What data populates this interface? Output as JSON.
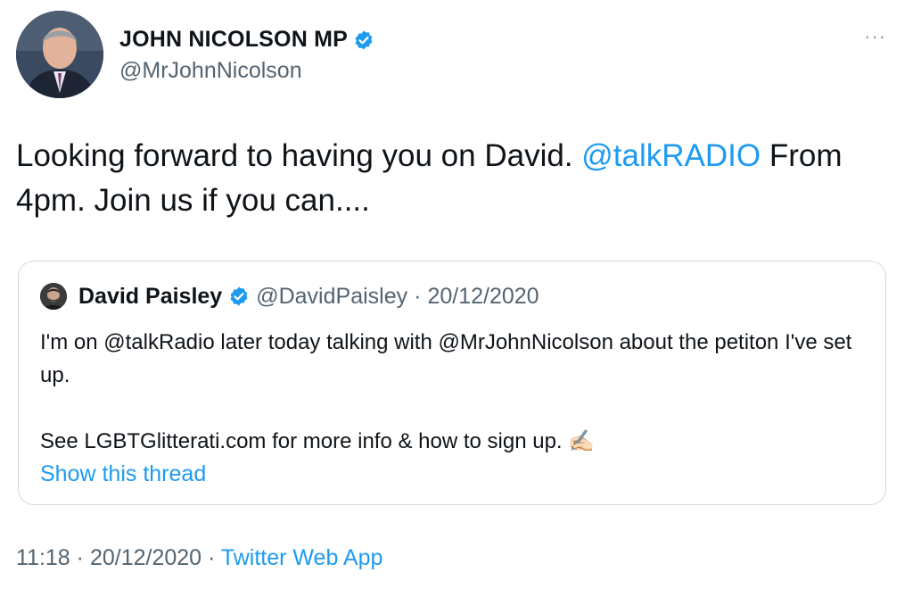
{
  "author": {
    "name": "JOHN NICOLSON MP",
    "handle": "@MrJohnNicolson",
    "verified_icon": "verified-badge-icon",
    "more_icon": "more-options-icon",
    "more_glyph": "···"
  },
  "tweet": {
    "text_before": "Looking forward to having you on David. ",
    "mention": "@talkRADIO",
    "text_after": " From 4pm. Join us if you can...."
  },
  "quote": {
    "name": "David Paisley",
    "handle": "@DavidPaisley",
    "separator": "·",
    "date": "20/12/2020",
    "line1": "I'm on @talkRadio later today talking with @MrJohnNicolson about the petiton I've set up.",
    "line2": "See LGBTGlitterati.com for more info & how to sign up.",
    "emoji": "✍🏻",
    "show_thread": "Show this thread"
  },
  "meta": {
    "time": "11:18",
    "separator1": " · ",
    "date": "20/12/2020",
    "separator2": " · ",
    "source": "Twitter Web App"
  },
  "colors": {
    "link": "#1d9bf0",
    "secondary_text": "#536471",
    "border": "#cfd9de",
    "verified": "#1d9bf0"
  }
}
